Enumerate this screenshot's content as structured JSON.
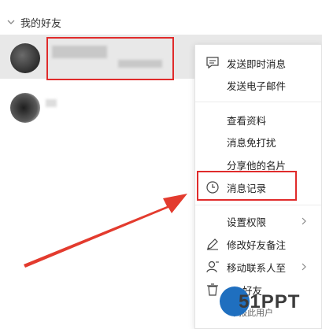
{
  "group": {
    "label": "我的好友"
  },
  "menu": {
    "items": [
      {
        "label": "发送即时消息",
        "icon": "message-icon"
      },
      {
        "label": "发送电子邮件"
      },
      {
        "label": "查看资料"
      },
      {
        "label": "消息免打扰"
      },
      {
        "label": "分享他的名片"
      },
      {
        "label": "消息记录",
        "icon": "clock-icon"
      },
      {
        "label": "设置权限"
      },
      {
        "label": "修改好友备注",
        "icon": "pencil-icon"
      },
      {
        "label": "移动联系人至",
        "icon": "user-icon"
      },
      {
        "label": "好友",
        "icon": "trash-icon"
      },
      {
        "label": "举报此用户"
      }
    ]
  },
  "watermark": {
    "text": "51PPT"
  },
  "colors": {
    "highlight": "#e02b2b",
    "selected_row": "#e8e8e8"
  }
}
